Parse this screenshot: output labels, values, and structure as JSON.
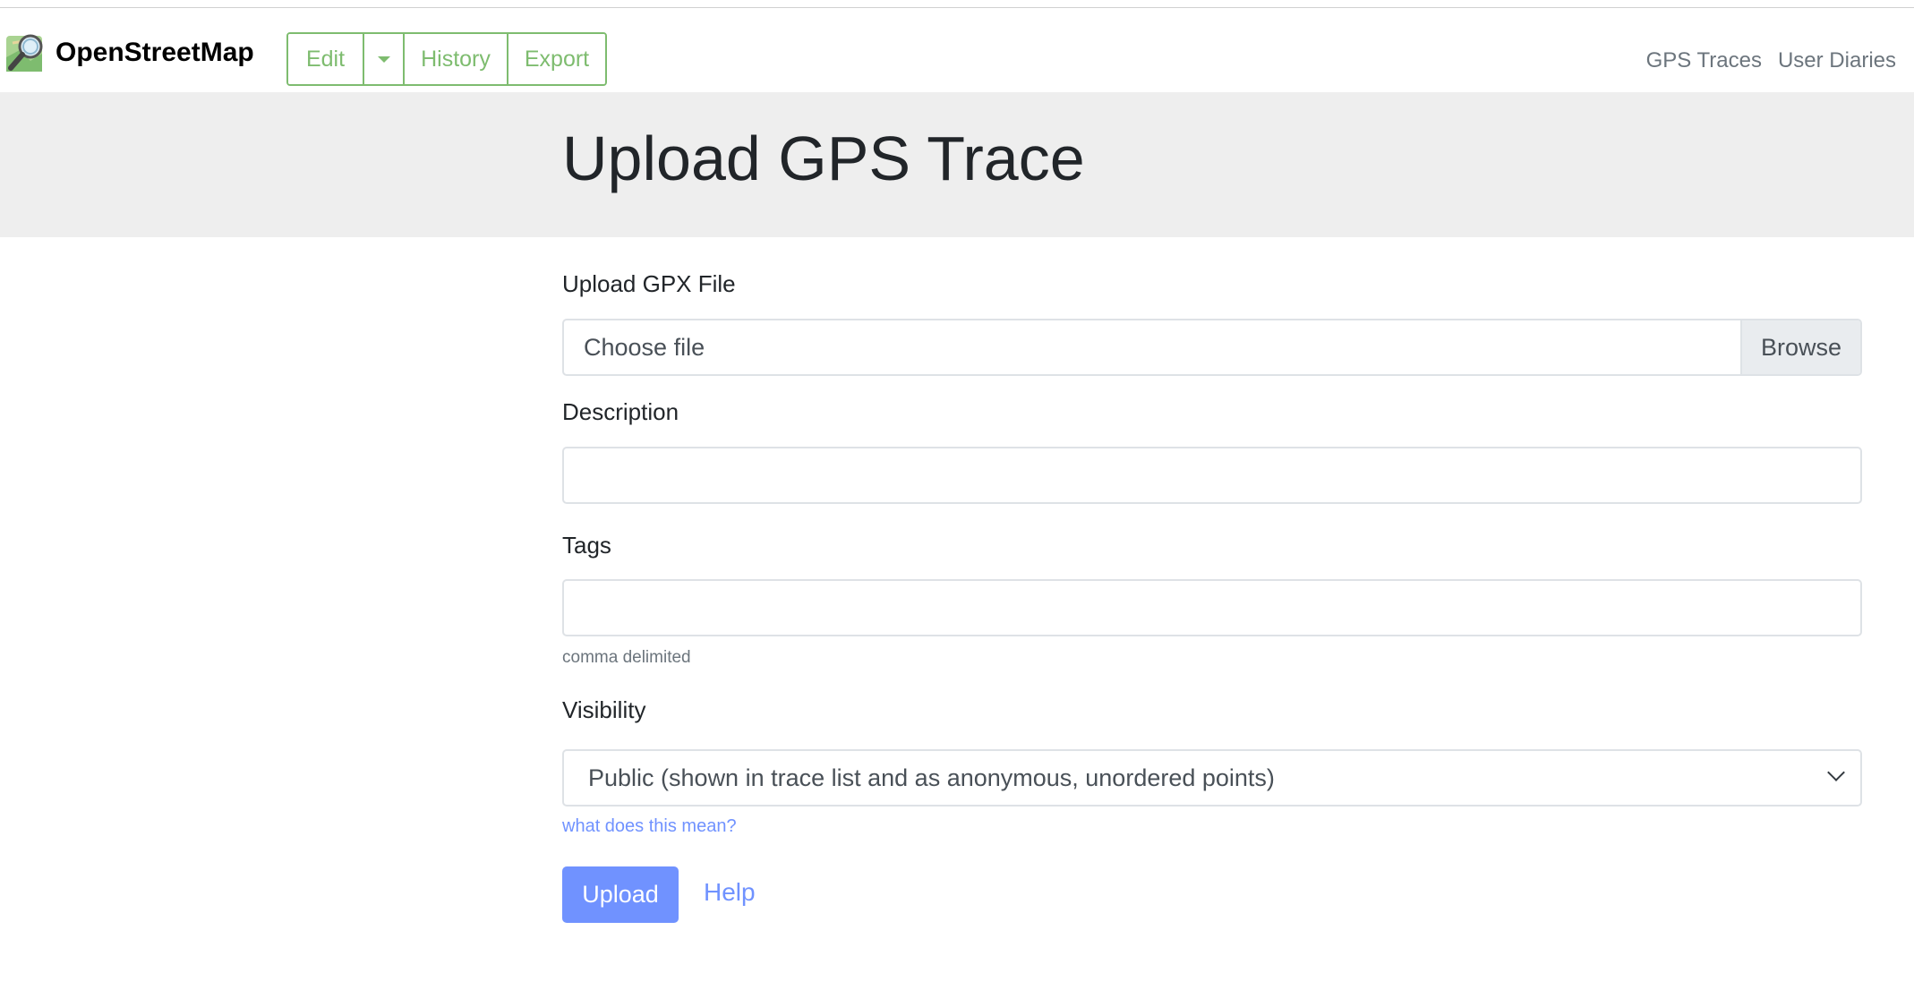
{
  "header": {
    "logo_text": "OpenStreetMap",
    "nav_buttons": {
      "edit": "Edit",
      "history": "History",
      "export": "Export"
    },
    "right_links": {
      "gps_traces": "GPS Traces",
      "user_diaries": "User Diaries"
    }
  },
  "page": {
    "title": "Upload GPS Trace"
  },
  "form": {
    "file": {
      "label": "Upload GPX File",
      "value": "Choose file",
      "browse_label": "Browse"
    },
    "description": {
      "label": "Description",
      "value": ""
    },
    "tags": {
      "label": "Tags",
      "value": "",
      "help": "comma delimited"
    },
    "visibility": {
      "label": "Visibility",
      "selected": "Public (shown in trace list and as anonymous, unordered points)",
      "help_link": "what does this mean?"
    },
    "upload_label": "Upload",
    "help_label": "Help"
  },
  "colors": {
    "brand_green": "#7ebc6f",
    "primary_blue": "#7092ff",
    "band_gray": "#eeeeee"
  }
}
